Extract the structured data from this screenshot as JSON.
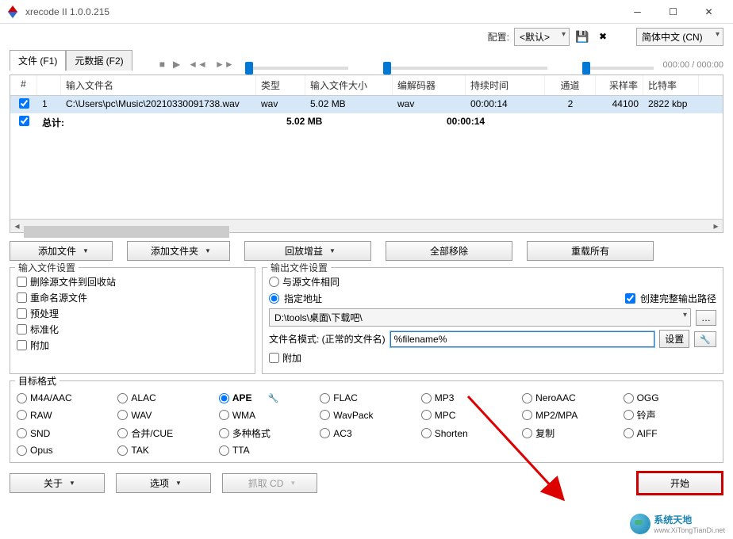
{
  "window": {
    "title": "xrecode II 1.0.0.215"
  },
  "toprow": {
    "config_label": "配置:",
    "config_value": "<默认>",
    "language": "简体中文 (CN)",
    "save_icon": "save-icon",
    "delete_icon": "delete-icon"
  },
  "tabs": {
    "files": "文件 (F1)",
    "metadata": "元数据 (F2)"
  },
  "player": {
    "time": "000:00 / 000:00"
  },
  "table": {
    "headers": {
      "num": "#",
      "name": "输入文件名",
      "type": "类型",
      "size": "输入文件大小",
      "codec": "编解码器",
      "duration": "持续时间",
      "channels": "通道",
      "samplerate": "采样率",
      "bitrate": "比特率"
    },
    "rows": [
      {
        "checked": true,
        "num": "1",
        "name": "C:\\Users\\pc\\Music\\20210330091738.wav",
        "type": "wav",
        "size": "5.02 MB",
        "codec": "wav",
        "duration": "00:00:14",
        "channels": "2",
        "samplerate": "44100",
        "bitrate": "2822 kbp"
      }
    ],
    "total": {
      "checked": true,
      "label": "总计:",
      "size": "5.02 MB",
      "duration": "00:00:14"
    }
  },
  "buttons": {
    "add_file": "添加文件",
    "add_folder": "添加文件夹",
    "replay_gain": "回放增益",
    "remove_all": "全部移除",
    "reload_all": "重载所有"
  },
  "input_settings": {
    "legend": "输入文件设置",
    "delete_to_recycle": "删除源文件到回收站",
    "rename_source": "重命名源文件",
    "preprocess": "预处理",
    "normalize": "标准化",
    "append": "附加"
  },
  "output_settings": {
    "legend": "输出文件设置",
    "same_as_source": "与源文件相同",
    "specify_path": "指定地址",
    "create_full_path": "创建完整输出路径",
    "path": "D:\\tools\\桌面\\下载吧\\",
    "filename_mode_label": "文件名模式: (正常的文件名)",
    "filename_pattern": "%filename%",
    "settings_btn": "设置",
    "append": "附加"
  },
  "formats": {
    "legend": "目标格式",
    "items": [
      {
        "id": "m4a",
        "label": "M4A/AAC"
      },
      {
        "id": "alac",
        "label": "ALAC"
      },
      {
        "id": "ape",
        "label": "APE",
        "selected": true,
        "wrench": true
      },
      {
        "id": "flac",
        "label": "FLAC"
      },
      {
        "id": "mp3",
        "label": "MP3"
      },
      {
        "id": "neroaac",
        "label": "NeroAAC"
      },
      {
        "id": "ogg",
        "label": "OGG"
      },
      {
        "id": "raw",
        "label": "RAW"
      },
      {
        "id": "wav",
        "label": "WAV"
      },
      {
        "id": "wma",
        "label": "WMA"
      },
      {
        "id": "wavpack",
        "label": "WavPack"
      },
      {
        "id": "mpc",
        "label": "MPC"
      },
      {
        "id": "mp2mpa",
        "label": "MP2/MPA"
      },
      {
        "id": "ringtone",
        "label": "铃声"
      },
      {
        "id": "snd",
        "label": "SND"
      },
      {
        "id": "merge",
        "label": "合并/CUE"
      },
      {
        "id": "multi",
        "label": "多种格式"
      },
      {
        "id": "ac3",
        "label": "AC3"
      },
      {
        "id": "shorten",
        "label": "Shorten"
      },
      {
        "id": "copy",
        "label": "复制"
      },
      {
        "id": "aiff",
        "label": "AIFF"
      },
      {
        "id": "opus",
        "label": "Opus"
      },
      {
        "id": "tak",
        "label": "TAK"
      },
      {
        "id": "tta",
        "label": "TTA"
      }
    ]
  },
  "bottom": {
    "about": "关于",
    "options": "选项",
    "grab_cd": "抓取 CD",
    "start": "开始"
  },
  "watermark": {
    "name": "系统天地",
    "url": "www.XiTongTianDi.net"
  }
}
